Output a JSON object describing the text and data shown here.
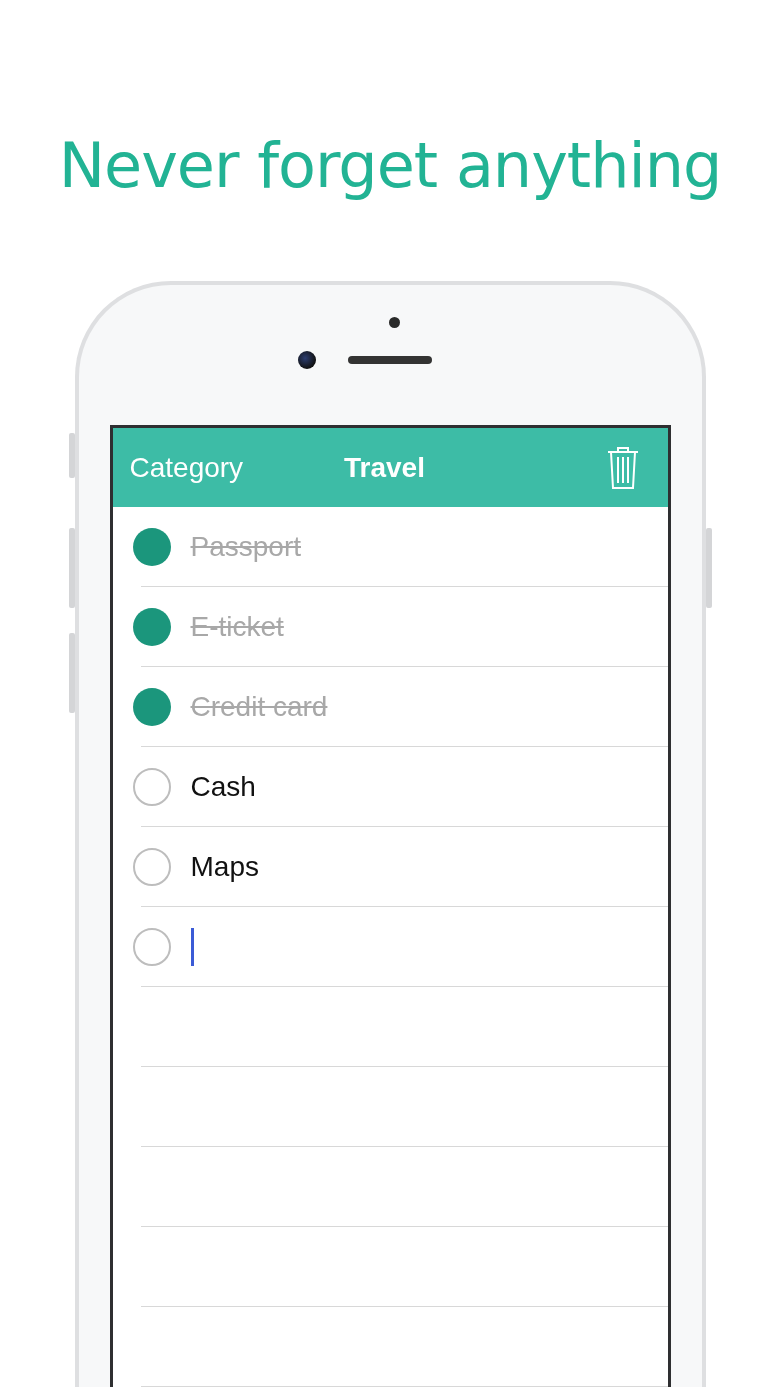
{
  "headline": "Never forget anything",
  "nav_bar": {
    "left": "Category",
    "title": "Travel"
  },
  "items": [
    {
      "text": "Passport",
      "checked": true
    },
    {
      "text": "E-ticket",
      "checked": true
    },
    {
      "text": "Credit card",
      "checked": true
    },
    {
      "text": "Cash",
      "checked": false
    },
    {
      "text": "Maps",
      "checked": false
    }
  ],
  "new_item": {
    "checked": false
  }
}
